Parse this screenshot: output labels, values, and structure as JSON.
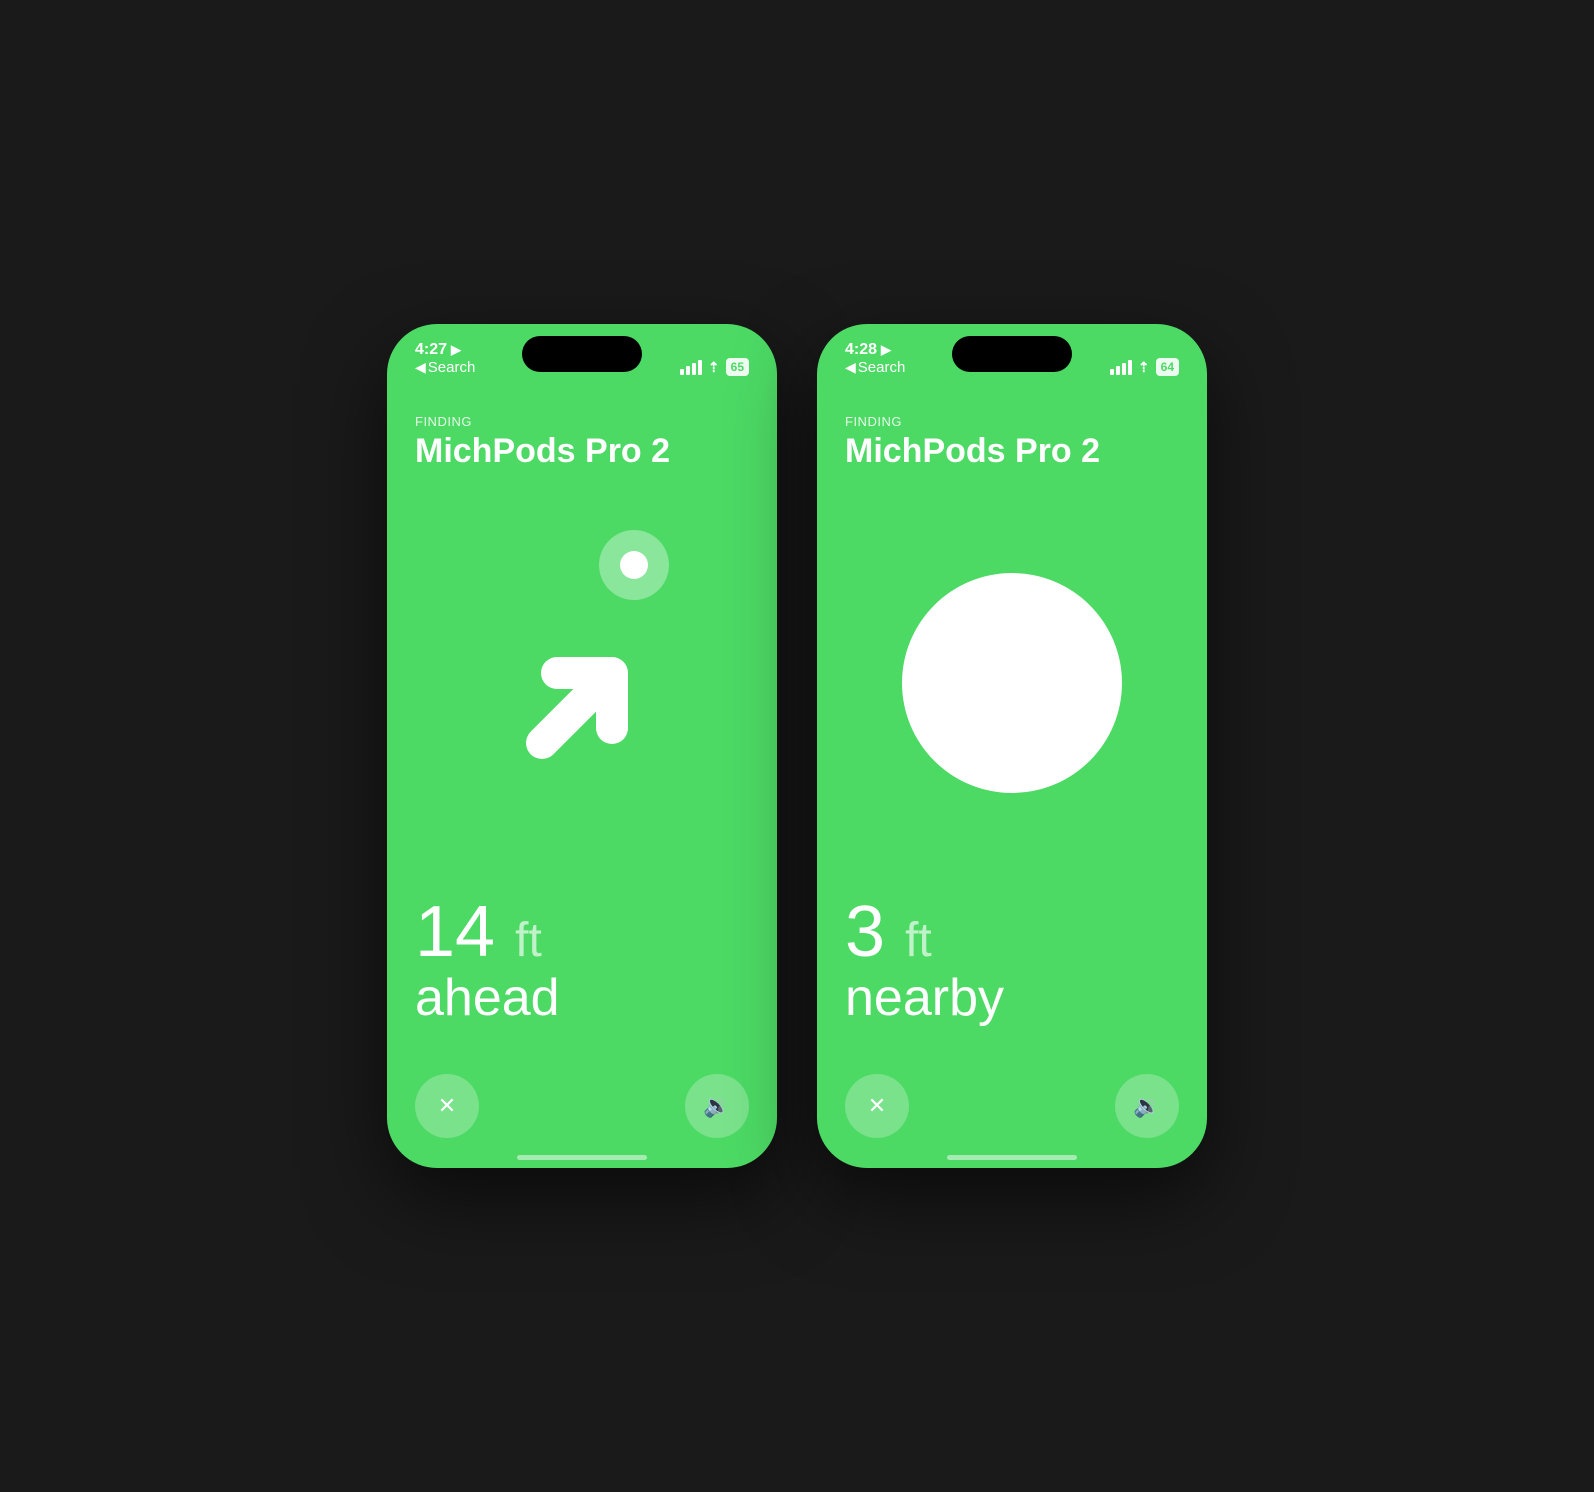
{
  "phone1": {
    "status": {
      "time": "4:27",
      "location_icon": "▶",
      "back_label": "Search",
      "battery": "65"
    },
    "header": {
      "finding_label": "FINDING",
      "device_name": "MichPods Pro 2"
    },
    "distance": {
      "value": "14",
      "unit": "ft",
      "direction": "ahead"
    },
    "close_button_label": "✕",
    "sound_button_label": "🔈"
  },
  "phone2": {
    "status": {
      "time": "4:28",
      "location_icon": "▶",
      "back_label": "Search",
      "battery": "64"
    },
    "header": {
      "finding_label": "FINDING",
      "device_name": "MichPods Pro 2"
    },
    "distance": {
      "value": "3",
      "unit": "ft",
      "direction": "nearby"
    },
    "close_button_label": "✕",
    "sound_button_label": "🔈"
  },
  "colors": {
    "green": "#4cd964",
    "dark": "#1a1a1a"
  }
}
